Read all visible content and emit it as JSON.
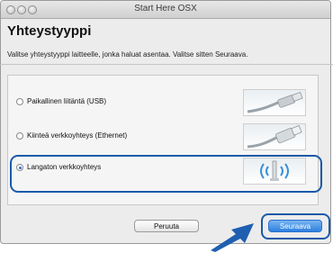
{
  "window": {
    "title": "Start Here OSX"
  },
  "page": {
    "heading": "Yhteystyyppi",
    "instruction": "Valitse yhteystyyppi laitteelle, jonka haluat asentaa. Valitse sitten Seuraava."
  },
  "options": [
    {
      "label": "Paikallinen liitäntä (USB)",
      "selected": false,
      "icon": "usb-cable-icon"
    },
    {
      "label": "Kiinteä verkkoyhteys (Ethernet)",
      "selected": false,
      "icon": "ethernet-cable-icon"
    },
    {
      "label": "Langaton verkkoyhteys",
      "selected": true,
      "icon": "wireless-icon"
    }
  ],
  "buttons": {
    "cancel": "Peruuta",
    "next": "Seuraava"
  },
  "colors": {
    "highlight": "#1a5aa8",
    "accent": "#2d82e0"
  }
}
